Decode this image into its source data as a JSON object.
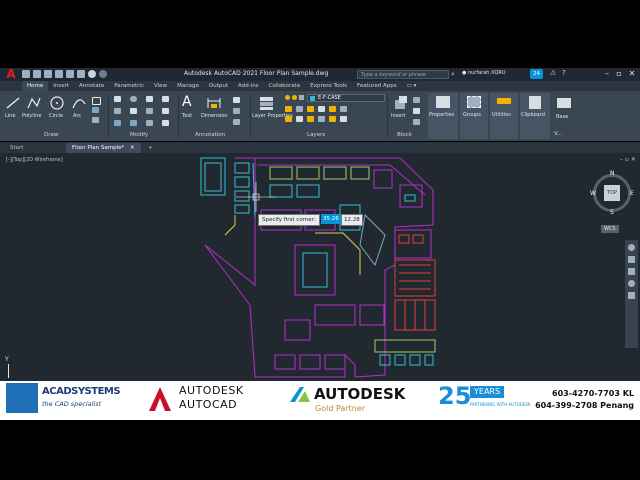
{
  "window": {
    "title": "Autodesk AutoCAD 2021    Floor Plan Sample.dwg",
    "search_placeholder": "Type a keyword or phrase",
    "user": "nurfarah.XQRU",
    "notification_count": "24"
  },
  "ribbon_tabs": [
    "Home",
    "Insert",
    "Annotate",
    "Parametric",
    "View",
    "Manage",
    "Output",
    "Add-ins",
    "Collaborate",
    "Express Tools",
    "Featured Apps"
  ],
  "ribbon": {
    "draw": {
      "label": "Draw",
      "tools": [
        "Line",
        "Polyline",
        "Circle",
        "Arc"
      ]
    },
    "modify": {
      "label": "Modify"
    },
    "annotation": {
      "label": "Annotation",
      "tools": [
        "Text",
        "Dimension"
      ]
    },
    "layers": {
      "label": "Layers",
      "tool": "Layer Properties",
      "current_layer": "E-F-CASE"
    },
    "block": {
      "label": "Block",
      "tool": "Insert"
    },
    "extra_tools": [
      "Properties",
      "Groups",
      "Utilities",
      "Clipboard",
      "Base"
    ],
    "view_label": "V..."
  },
  "doc_tabs": [
    "Start",
    "Floor Plan Sample*"
  ],
  "viewport_label": "[-][Top][2D Wireframe]",
  "viewcube": {
    "top": "TOP",
    "n": "N",
    "s": "S",
    "e": "E",
    "w": "W",
    "wcs": "WCS"
  },
  "prompt": {
    "text": "Specify first corner:",
    "x": "35.26",
    "y": "12.28"
  },
  "ucs_axis": "Y",
  "banner": {
    "acad_line1": "ACADSYSTEMS",
    "acad_line2": "the CAD specialist",
    "autodesk1": "AUTODESK",
    "autocad": "AUTOCAD",
    "autodesk2": "AUTODESK",
    "gold": "Gold Partner",
    "years": "25",
    "years_word": "YEARS",
    "years_sub": "PARTNERING WITH AUTODESK",
    "phone_kl": "603-4270-7703 KL",
    "phone_penang": "604-399-2708 Penang"
  },
  "colors": {
    "accent": "#0696d7",
    "autocad_red": "#e11b22",
    "ribbon": "#3b4653",
    "canvas": "#212830"
  }
}
